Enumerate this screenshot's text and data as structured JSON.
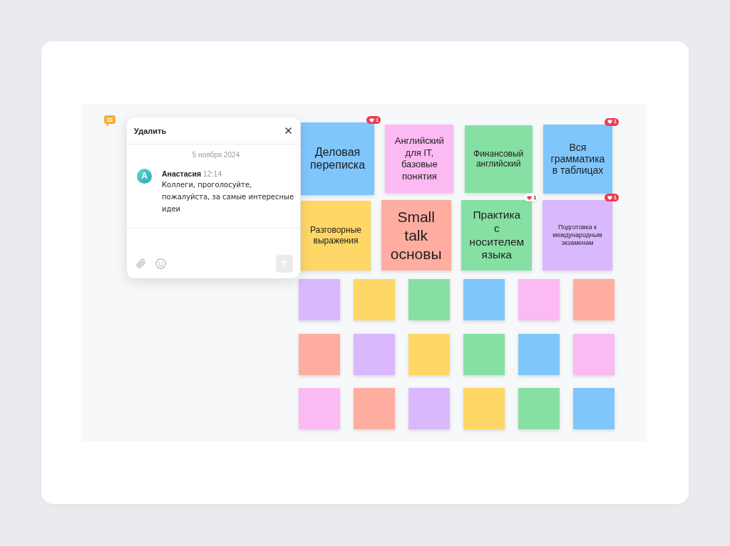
{
  "comment_panel": {
    "delete_label": "Удалить",
    "date": "5 ноября 2024",
    "messages": [
      {
        "avatar_letter": "А",
        "author": "Анастасия",
        "time": "12:14",
        "text": "Коллеги, проголосуйте, пожалуйста, за самые интересные идеи"
      }
    ],
    "send_button": {
      "disabled": true
    }
  },
  "notes": [
    {
      "text": "Деловая переписка",
      "color": "#7fc6fd",
      "likes": {
        "count": "1",
        "liked_by_me": true
      }
    },
    {
      "text": "Английский для IT, базовые понятия",
      "color": "#fcbaf2"
    },
    {
      "text": "Финансовый английский",
      "color": "#86e0a3"
    },
    {
      "text": "Вся грамматика в таблицах",
      "color": "#7fc6fd",
      "likes": {
        "count": "1",
        "liked_by_me": true
      }
    },
    {
      "text": "Разговорные выражения",
      "color": "#fed766"
    },
    {
      "text": "Small talk основы",
      "color": "#feada0"
    },
    {
      "text": "Практика с носителем языка",
      "color": "#86e0a3",
      "likes": {
        "count": "1",
        "liked_by_me": false
      }
    },
    {
      "text": "Подготовка к международным экзаменам",
      "color": "#d9b8fd",
      "likes": {
        "count": "1",
        "liked_by_me": true
      }
    }
  ],
  "empty_notes": [
    {
      "color": "#d9b8fd"
    },
    {
      "color": "#fed766"
    },
    {
      "color": "#86e0a3"
    },
    {
      "color": "#7fc6fd"
    },
    {
      "color": "#fcbaf2"
    },
    {
      "color": "#feada0"
    },
    {
      "color": "#feada0"
    },
    {
      "color": "#d9b8fd"
    },
    {
      "color": "#fed766"
    },
    {
      "color": "#86e0a3"
    },
    {
      "color": "#7fc6fd"
    },
    {
      "color": "#fcbaf2"
    },
    {
      "color": "#fcbaf2"
    },
    {
      "color": "#feada0"
    },
    {
      "color": "#d9b8fd"
    },
    {
      "color": "#fed766"
    },
    {
      "color": "#86e0a3"
    },
    {
      "color": "#7fc6fd"
    }
  ]
}
